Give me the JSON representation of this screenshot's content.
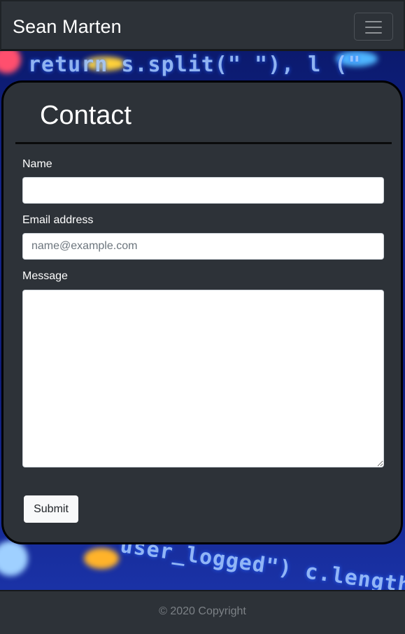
{
  "navbar": {
    "brand": "Sean Marten",
    "toggle_icon": "hamburger-menu-icon"
  },
  "hero": {
    "background_text_top": "return s.split(\" \"), l (\"",
    "background_text_bottom": "user_logged\") c.length"
  },
  "contact": {
    "title": "Contact",
    "name_label": "Name",
    "name_value": "",
    "email_label": "Email address",
    "email_placeholder": "name@example.com",
    "message_label": "Message",
    "message_value": "",
    "submit_label": "Submit"
  },
  "footer": {
    "copyright": "© 2020 Copyright"
  },
  "colors": {
    "navbar_bg": "#2d3238",
    "card_bg": "#2d3238",
    "card_border": "#000000",
    "footer_text": "#7c8186",
    "button_bg": "#f8f9fa"
  }
}
